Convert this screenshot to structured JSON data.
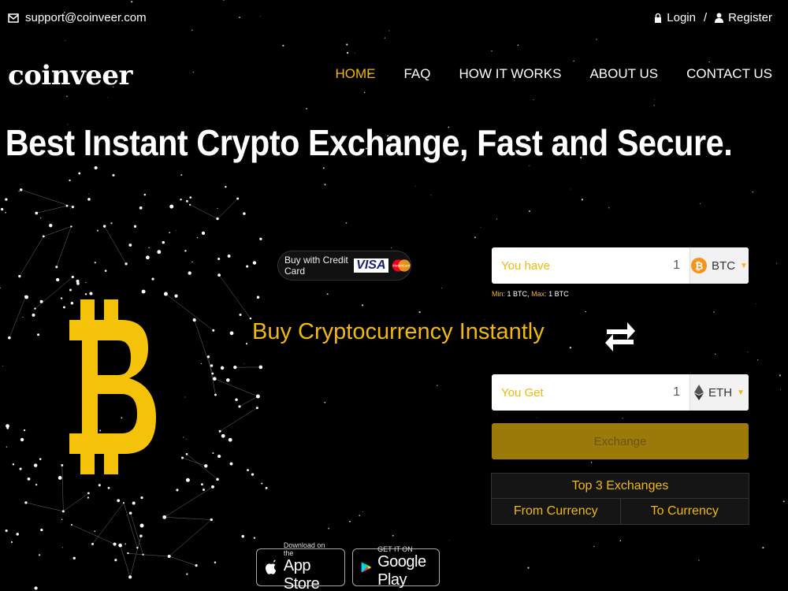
{
  "topbar": {
    "email": "support@coinveer.com",
    "login": "Login",
    "separator": "/",
    "register": "Register"
  },
  "brand": {
    "name": "coinveer"
  },
  "nav": [
    {
      "label": "HOME",
      "active": true
    },
    {
      "label": "FAQ",
      "active": false
    },
    {
      "label": "HOW IT WORKS",
      "active": false
    },
    {
      "label": "ABOUT US",
      "active": false
    },
    {
      "label": "CONTACT US",
      "active": false
    }
  ],
  "hero": {
    "title": "Best Instant Crypto Exchange, Fast and Secure.",
    "subtitle": "Buy Cryptocurrency Instantly"
  },
  "credit_card": {
    "label": "Buy with Credit Card",
    "visa": "VISA",
    "mastercard": "MasterCard"
  },
  "exchange": {
    "have_label": "You have",
    "have_value": "1",
    "have_currency": "BTC",
    "limits_min_label": "Min:",
    "limits_min_value": "1 BTC",
    "limits_sep": ",",
    "limits_max_label": "Max:",
    "limits_max_value": "1 BTC",
    "get_label": "You Get",
    "get_value": "1",
    "get_currency": "ETH",
    "button": "Exchange"
  },
  "top3": {
    "title": "Top 3 Exchanges",
    "from": "From Currency",
    "to": "To Currency"
  },
  "stores": {
    "apple_small": "Download on the",
    "apple_big": "App Store",
    "google_small": "GET IT ON",
    "google_big": "Google Play"
  },
  "colors": {
    "accent": "#f0b90b",
    "background": "#000000",
    "button": "#9b7a0a"
  }
}
